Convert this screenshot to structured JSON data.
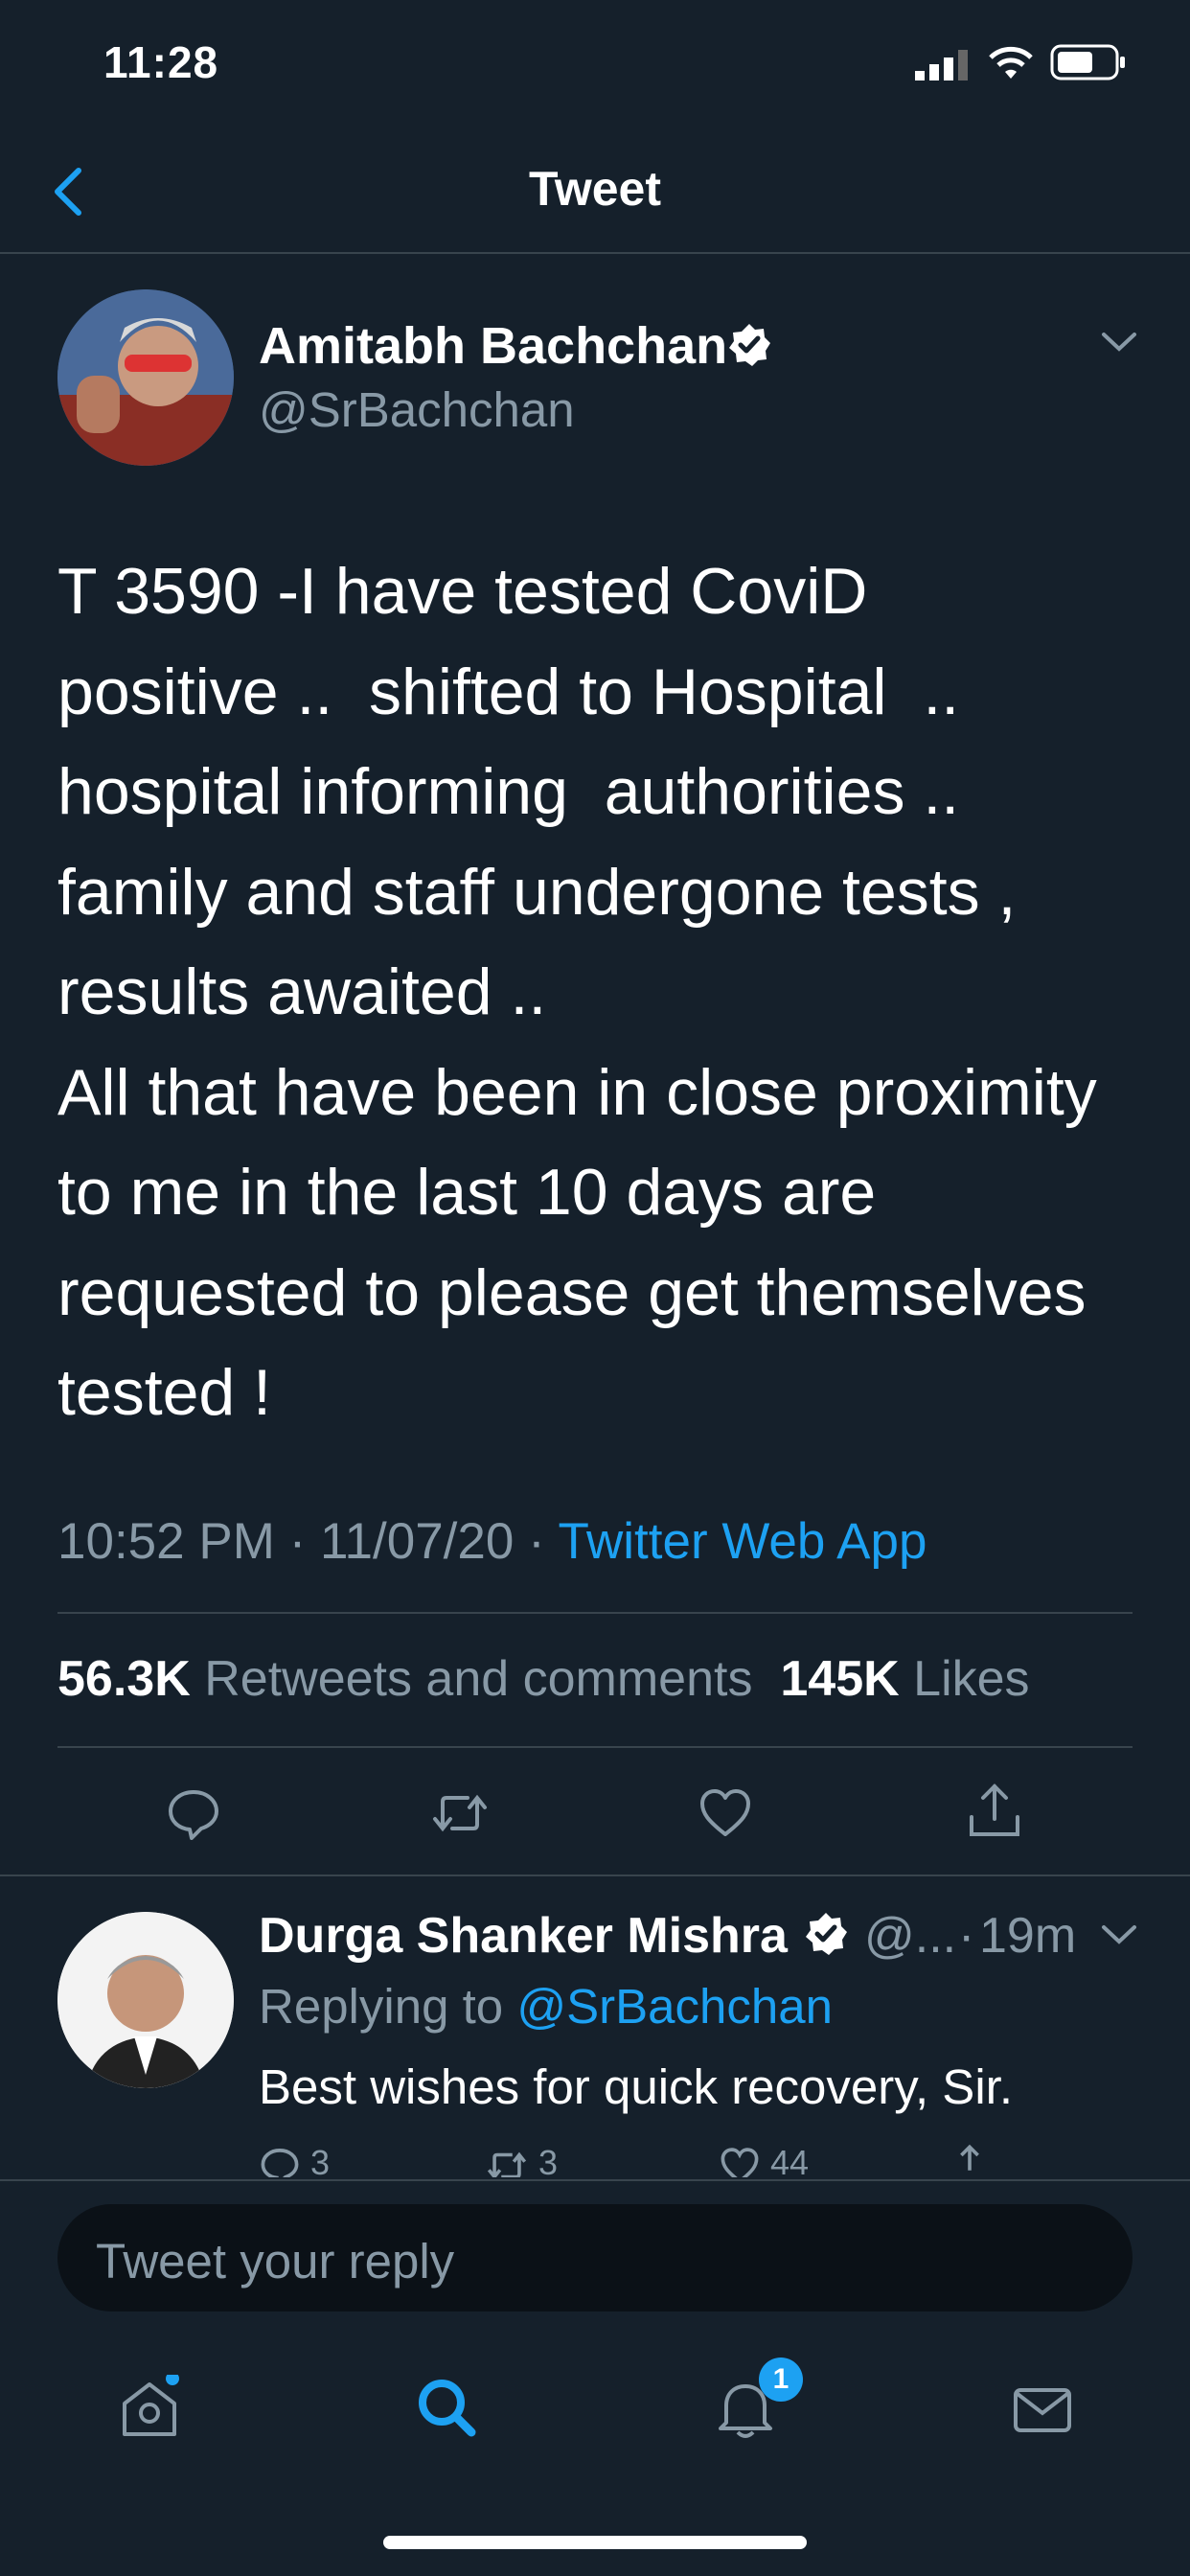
{
  "status_bar": {
    "time": "11:28"
  },
  "nav": {
    "title": "Tweet"
  },
  "tweet": {
    "author_name": "Amitabh Bachchan",
    "author_handle": "@SrBachchan",
    "text": "T 3590 -I have tested CoviD\npositive ..  shifted to Hospital  ..\nhospital informing  authorities ..\nfamily and staff undergone tests ,\nresults awaited ..\nAll that have been in close proximity\nto me in the last 10 days are\nrequested to please get themselves\ntested !",
    "time": "10:52 PM",
    "date": "11/07/20",
    "separator": "·",
    "source": "Twitter Web App",
    "retweets_count": "56.3K",
    "retweets_label": "Retweets and comments",
    "likes_count": "145K",
    "likes_label": "Likes"
  },
  "reply": {
    "author_name": "Durga Shanker Mishra",
    "author_handle": "@...",
    "time": "19m",
    "replying_to_label": "Replying to",
    "replying_to_handle": "@SrBachchan",
    "text": "Best wishes for quick recovery, Sir.",
    "comments": "3",
    "retweets": "3",
    "likes": "44"
  },
  "composer": {
    "placeholder": "Tweet your reply"
  },
  "tabbar": {
    "notifications_badge": "1"
  },
  "colors": {
    "background": "#15202b",
    "accent": "#1da1f2",
    "muted": "#8899a6",
    "divider": "#38444d"
  }
}
